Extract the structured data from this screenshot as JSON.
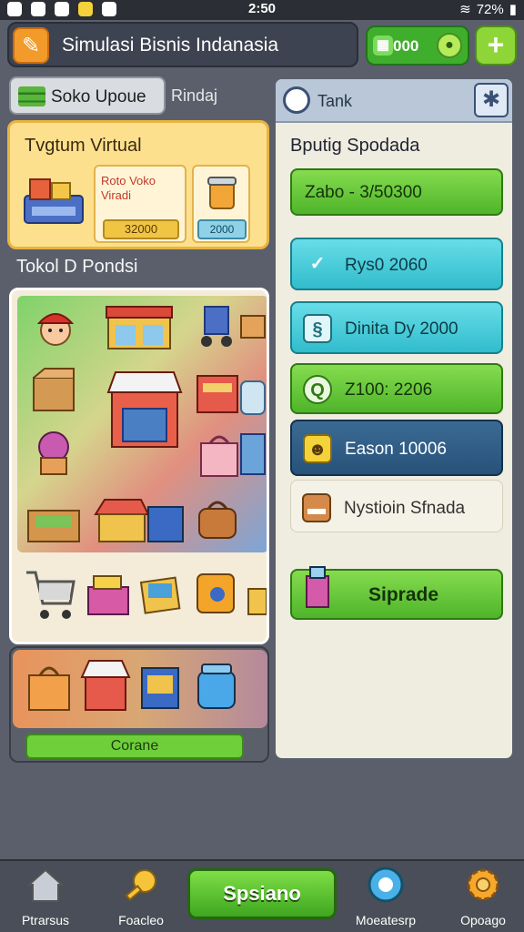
{
  "status_bar": {
    "time": "2:50",
    "battery": "72%"
  },
  "header": {
    "title": "Simulasi Bisnis Indanasia",
    "coins_value": "000",
    "add_label": "+"
  },
  "store_tab": {
    "label": "Soko Upoue",
    "subtitle": "Rindaj"
  },
  "virtual_card": {
    "title": "Tvgtum Virtual",
    "promo_text": "Roto Voko Viradi",
    "promo_price": "32000",
    "item_price": "2000"
  },
  "section_title": "Tokol D Pondsi",
  "create_button": "Corane",
  "task_panel": {
    "title": "Tank",
    "subtitle": "Bputig Spodada",
    "tasks": [
      {
        "label": "Zabo - 3/50300",
        "icon": ""
      },
      {
        "label": "Rys0 2060",
        "icon": "✓"
      },
      {
        "label": "Dinita Dy 2000",
        "icon": "§"
      },
      {
        "label": "Z100: 2206",
        "icon": "Q"
      },
      {
        "label": "Eason 10006",
        "icon": "☻"
      },
      {
        "label": "Nystioin Sfnada",
        "icon": "▬"
      }
    ],
    "upgrade_label": "Siprade"
  },
  "bottom_nav": {
    "items": [
      {
        "label": "Ptrarsus"
      },
      {
        "label": "Foacleo"
      },
      {
        "label": "Moeatesrp"
      },
      {
        "label": "Opoago"
      }
    ],
    "center_label": "Spsiano"
  }
}
